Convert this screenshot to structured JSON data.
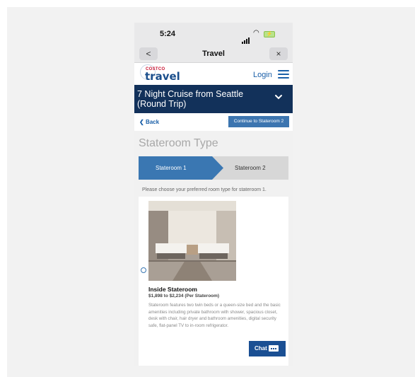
{
  "status_bar": {
    "time": "5:24"
  },
  "browser": {
    "title": "Travel",
    "back_glyph": "<",
    "close_glyph": "×"
  },
  "header": {
    "logo_brand": "COSTCO",
    "logo_text": "travel",
    "login_label": "Login"
  },
  "cruise": {
    "title": "7 Night Cruise from Seattle (Round Trip)"
  },
  "nav": {
    "back_label": "Back",
    "continue_label": "Continue to Stateroom 2"
  },
  "page": {
    "heading": "Stateroom Type",
    "steps": [
      {
        "label": "Stateroom 1",
        "active": true
      },
      {
        "label": "Stateroom 2",
        "active": false
      }
    ],
    "prompt": "Please choose your preferred room type for stateroom 1."
  },
  "rooms": [
    {
      "name": "Inside Stateroom",
      "price": "$1,898 to $2,234 (Per Stateroom)",
      "description": "Stateroom features two twin beds or a queen-size bed and the basic amenities including private bathroom with shower, spacious closet, desk with chair, hair dryer and bathroom amenities, digital security safe, flat-panel TV to in-room refrigerator.",
      "selected": false
    }
  ],
  "chat": {
    "label": "Chat"
  },
  "colors": {
    "navy": "#12315a",
    "accent_blue": "#3a77b2",
    "brand_red": "#c8102e"
  },
  "icons": [
    "signal-icon",
    "wifi-icon",
    "battery-icon",
    "menu-icon",
    "chevron-down-icon",
    "chat-bubble-icon"
  ]
}
